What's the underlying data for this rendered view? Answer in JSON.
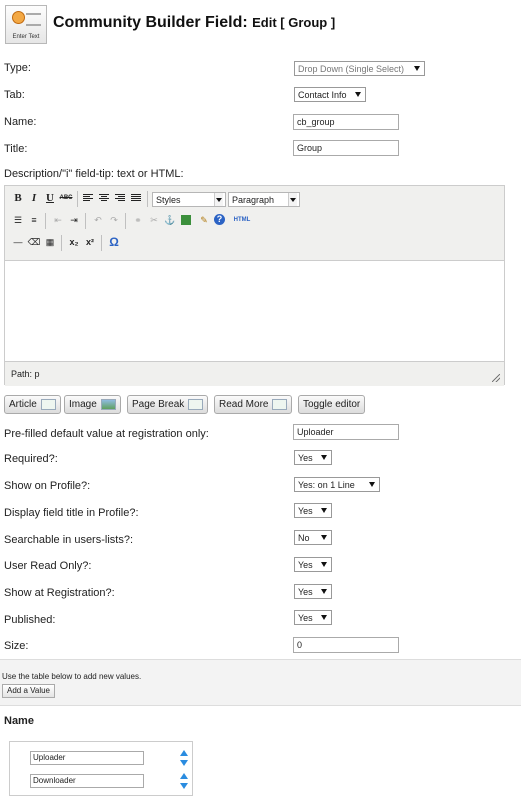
{
  "header": {
    "icon_caption": "Enter Text",
    "title": "Community Builder Field:",
    "subtitle": "Edit [ Group ]"
  },
  "form": {
    "type": {
      "label": "Type:",
      "value": "Drop Down (Single Select)"
    },
    "tab": {
      "label": "Tab:",
      "value": "Contact Info"
    },
    "name": {
      "label": "Name:",
      "value": "cb_group"
    },
    "title": {
      "label": "Title:",
      "value": "Group"
    },
    "description": {
      "label": "Description/\"i\" field-tip: text or HTML:"
    }
  },
  "editor": {
    "styles_select": "Styles",
    "format_select": "Paragraph",
    "path_text": "Path: p",
    "icons": {
      "bold": "B",
      "italic": "I",
      "underline": "U",
      "strike": "ABC",
      "subscript": "x₂",
      "superscript": "x²",
      "html": "HTML",
      "omega": "Ω",
      "help": "?"
    }
  },
  "editor_buttons": {
    "article": "Article",
    "image": "Image",
    "page_break": "Page Break",
    "read_more": "Read More",
    "toggle": "Toggle editor"
  },
  "options": {
    "prefilled": {
      "label": "Pre-filled default value at registration only:",
      "value": "Uploader"
    },
    "required": {
      "label": "Required?:",
      "value": "Yes"
    },
    "show_on_profile": {
      "label": "Show on Profile?:",
      "value": "Yes: on 1 Line"
    },
    "display_title": {
      "label": "Display field title in Profile?:",
      "value": "Yes"
    },
    "searchable": {
      "label": "Searchable in users-lists?:",
      "value": "No"
    },
    "user_read_only": {
      "label": "User Read Only?:",
      "value": "Yes"
    },
    "show_at_registration": {
      "label": "Show at Registration?:",
      "value": "Yes"
    },
    "published": {
      "label": "Published:",
      "value": "Yes"
    },
    "size": {
      "label": "Size:",
      "value": "0"
    }
  },
  "values_section": {
    "hint": "Use the table below to add new values.",
    "add_button": "Add a Value",
    "name_header": "Name",
    "values": [
      "Uploader",
      "Downloader"
    ]
  }
}
